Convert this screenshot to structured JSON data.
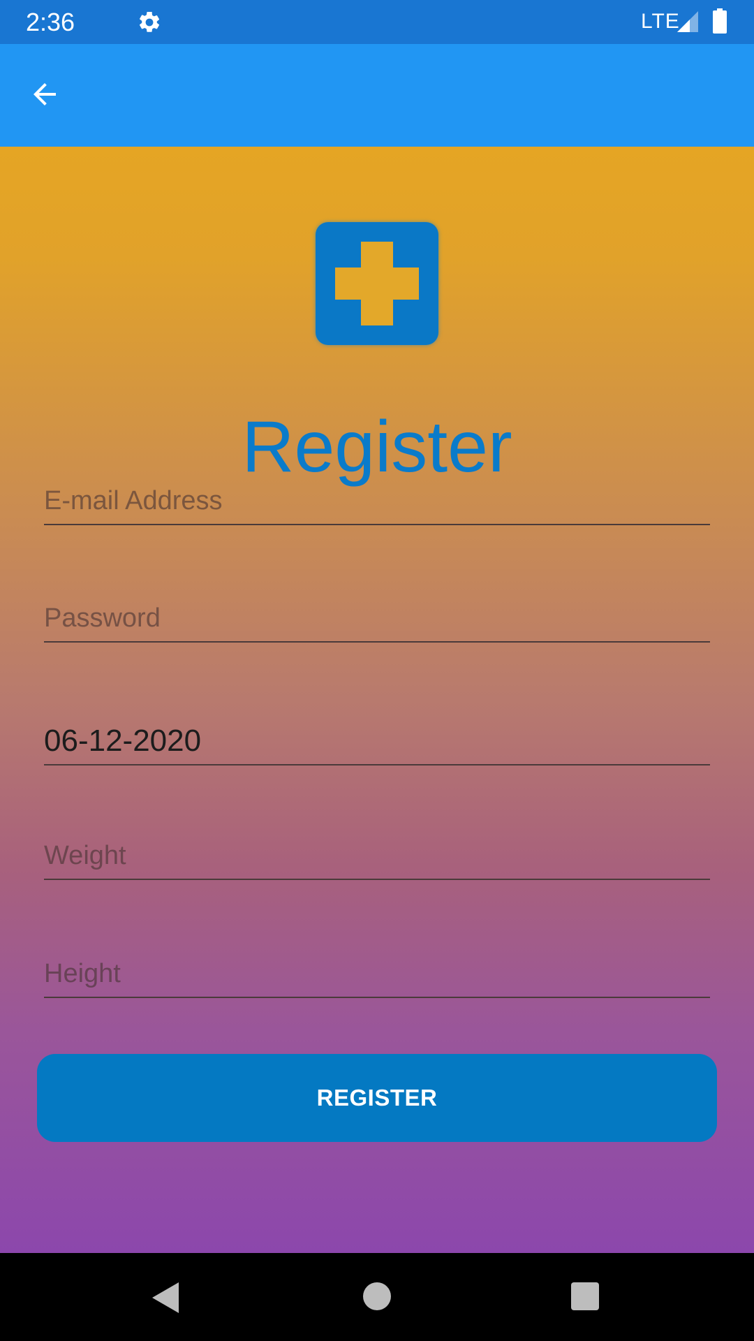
{
  "status_bar": {
    "time": "2:36",
    "network": "LTE",
    "icons": [
      "gear-icon",
      "signal-icon",
      "battery-icon"
    ]
  },
  "app_bar": {
    "back_icon": "arrow-left-icon"
  },
  "logo": {
    "icon": "medical-cross-icon"
  },
  "title": "Register",
  "form": {
    "email_placeholder": "E-mail Address",
    "password_placeholder": "Password",
    "date_value": "06-12-2020",
    "weight_placeholder": "Weight",
    "height_placeholder": "Height",
    "register_label": "REGISTER"
  },
  "nav_bar": {
    "icons": [
      "back-triangle-icon",
      "home-circle-icon",
      "recents-square-icon"
    ]
  },
  "colors": {
    "status_bar": "#1976d2",
    "app_bar": "#2196f3",
    "accent": "#0479c2",
    "gradient_top": "#e5a524",
    "gradient_bottom": "#8c47ac"
  }
}
